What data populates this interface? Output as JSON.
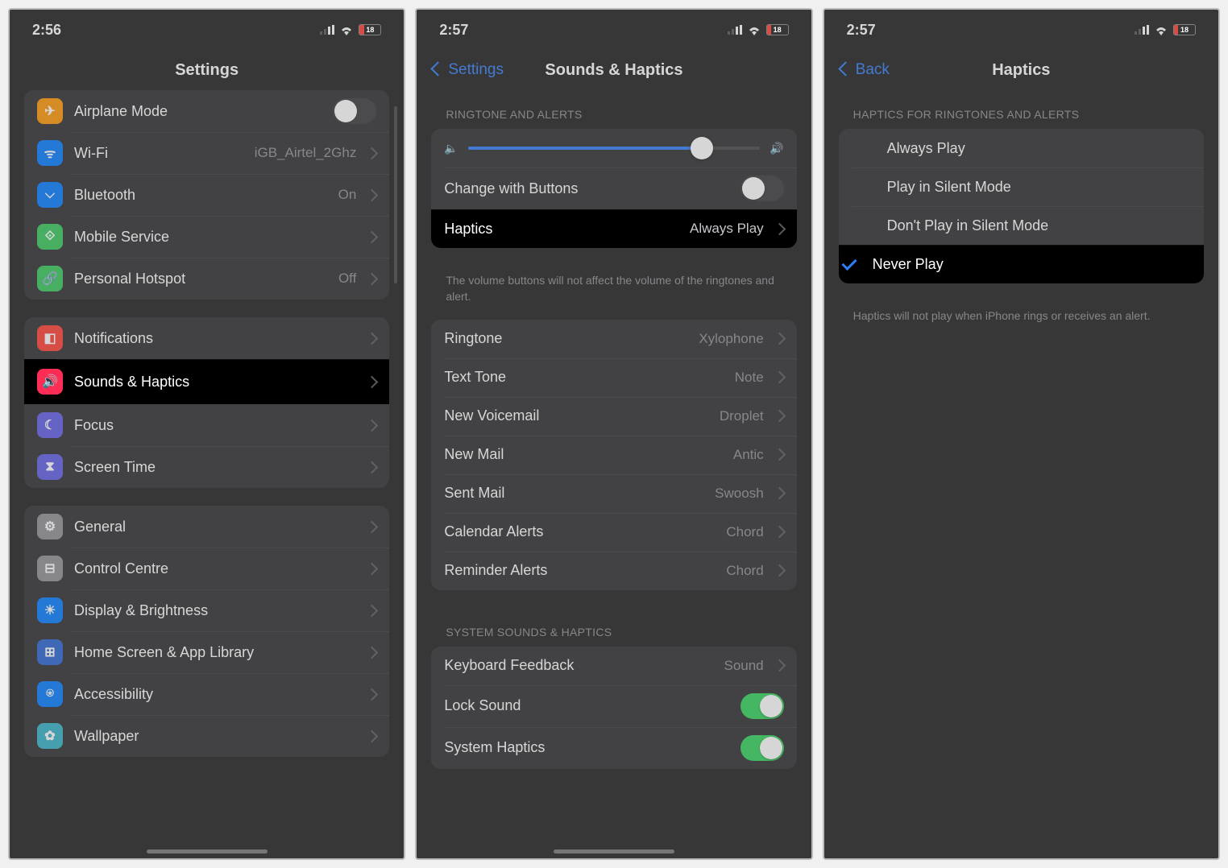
{
  "status": {
    "battery": "18"
  },
  "screen1": {
    "time": "2:56",
    "title": "Settings",
    "g1": [
      {
        "icon": "airplane",
        "color": "c-orange",
        "label": "Airplane Mode",
        "ctl": "toggle-off"
      },
      {
        "icon": "wifi",
        "color": "c-blue",
        "label": "Wi-Fi",
        "value": "iGB_Airtel_2Ghz",
        "chev": true
      },
      {
        "icon": "bluetooth",
        "color": "c-blue",
        "label": "Bluetooth",
        "value": "On",
        "chev": true
      },
      {
        "icon": "antenna",
        "color": "c-green",
        "label": "Mobile Service",
        "chev": true
      },
      {
        "icon": "link",
        "color": "c-green",
        "label": "Personal Hotspot",
        "value": "Off",
        "chev": true
      }
    ],
    "g2": [
      {
        "icon": "bell",
        "color": "c-red",
        "label": "Notifications",
        "chev": true
      },
      {
        "icon": "speaker",
        "color": "c-pink",
        "label": "Sounds & Haptics",
        "chev": true,
        "hl": true
      },
      {
        "icon": "moon",
        "color": "c-indigo",
        "label": "Focus",
        "chev": true
      },
      {
        "icon": "hourglass",
        "color": "c-indigo",
        "label": "Screen Time",
        "chev": true
      }
    ],
    "g3": [
      {
        "icon": "gear",
        "color": "c-gray",
        "label": "General",
        "chev": true
      },
      {
        "icon": "switches",
        "color": "c-gray",
        "label": "Control Centre",
        "chev": true
      },
      {
        "icon": "sun",
        "color": "c-blue",
        "label": "Display & Brightness",
        "chev": true
      },
      {
        "icon": "grid",
        "color": "c-dblue",
        "label": "Home Screen & App Library",
        "chev": true
      },
      {
        "icon": "person",
        "color": "c-blue",
        "label": "Accessibility",
        "chev": true
      },
      {
        "icon": "flower",
        "color": "c-teal",
        "label": "Wallpaper",
        "chev": true
      }
    ]
  },
  "screen2": {
    "time": "2:57",
    "back": "Settings",
    "title": "Sounds & Haptics",
    "header1": "Ringtone and Alerts",
    "slider_pct": 80,
    "changeButtons": {
      "label": "Change with Buttons",
      "on": false
    },
    "haptics": {
      "label": "Haptics",
      "value": "Always Play"
    },
    "footer1": "The volume buttons will not affect the volume of the ringtones and alert.",
    "tones": [
      {
        "label": "Ringtone",
        "value": "Xylophone"
      },
      {
        "label": "Text Tone",
        "value": "Note"
      },
      {
        "label": "New Voicemail",
        "value": "Droplet"
      },
      {
        "label": "New Mail",
        "value": "Antic"
      },
      {
        "label": "Sent Mail",
        "value": "Swoosh"
      },
      {
        "label": "Calendar Alerts",
        "value": "Chord"
      },
      {
        "label": "Reminder Alerts",
        "value": "Chord"
      }
    ],
    "header2": "System Sounds & Haptics",
    "sys": {
      "kb": {
        "label": "Keyboard Feedback",
        "value": "Sound"
      },
      "lock": {
        "label": "Lock Sound",
        "on": true
      },
      "hapt": {
        "label": "System Haptics",
        "on": true
      }
    }
  },
  "screen3": {
    "time": "2:57",
    "back": "Back",
    "title": "Haptics",
    "header": "Haptics for Ringtones and Alerts",
    "options": [
      {
        "label": "Always Play",
        "sel": false
      },
      {
        "label": "Play in Silent Mode",
        "sel": false
      },
      {
        "label": "Don't Play in Silent Mode",
        "sel": false
      },
      {
        "label": "Never Play",
        "sel": true
      }
    ],
    "footer": "Haptics will not play when iPhone rings or receives an alert."
  }
}
